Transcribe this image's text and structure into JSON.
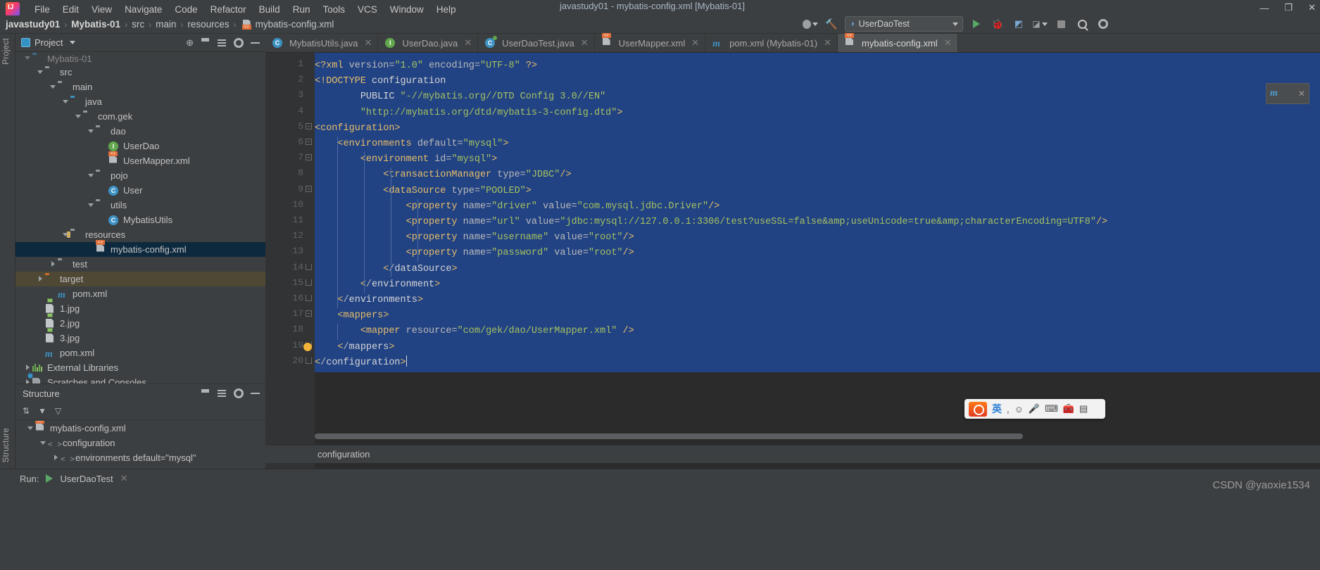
{
  "window": {
    "title": "javastudy01 - mybatis-config.xml [Mybatis-01]",
    "minimize": "—",
    "maximize": "❐",
    "close": "✕"
  },
  "menu": [
    {
      "label": "File"
    },
    {
      "label": "Edit"
    },
    {
      "label": "View"
    },
    {
      "label": "Navigate"
    },
    {
      "label": "Code"
    },
    {
      "label": "Refactor"
    },
    {
      "label": "Build"
    },
    {
      "label": "Run"
    },
    {
      "label": "Tools"
    },
    {
      "label": "VCS"
    },
    {
      "label": "Window"
    },
    {
      "label": "Help"
    }
  ],
  "breadcrumb": {
    "items": [
      "javastudy01",
      "Mybatis-01",
      "src",
      "main",
      "resources",
      "mybatis-config.xml"
    ],
    "separator": "›"
  },
  "run_config": {
    "name": "UserDaoTest",
    "run_icon": "play-icon",
    "debug_icon": "debug-icon",
    "coverage_icon": "coverage-icon",
    "profile_icon": "profile-icon",
    "stop_icon": "stop-icon",
    "search_icon": "search-icon",
    "settings_icon": "settings-icon",
    "avatar_icon": "user-icon",
    "build_icon": "hammer-icon"
  },
  "project_panel": {
    "title": "Project",
    "dropdown_icon": "chevron-down-icon",
    "toolbar_icons": [
      "target-icon",
      "collapse-all-icon",
      "expand-icon",
      "gear-icon",
      "hide-icon"
    ],
    "tree": [
      {
        "label": "Mybatis-01",
        "indent": 1,
        "arrow": "down",
        "icon": "module-icon",
        "state": "clipped"
      },
      {
        "label": "src",
        "indent": 2,
        "arrow": "down",
        "icon": "folder-icon"
      },
      {
        "label": "main",
        "indent": 3,
        "arrow": "down",
        "icon": "folder-icon"
      },
      {
        "label": "java",
        "indent": 4,
        "arrow": "down",
        "icon": "source-folder-icon"
      },
      {
        "label": "com.gek",
        "indent": 5,
        "arrow": "down",
        "icon": "package-icon"
      },
      {
        "label": "dao",
        "indent": 6,
        "arrow": "down",
        "icon": "package-icon"
      },
      {
        "label": "UserDao",
        "indent": 7,
        "arrow": "none",
        "icon": "interface-icon"
      },
      {
        "label": "UserMapper.xml",
        "indent": 7,
        "arrow": "none",
        "icon": "xml-icon"
      },
      {
        "label": "pojo",
        "indent": 6,
        "arrow": "down",
        "icon": "package-icon"
      },
      {
        "label": "User",
        "indent": 7,
        "arrow": "none",
        "icon": "class-icon"
      },
      {
        "label": "utils",
        "indent": 6,
        "arrow": "down",
        "icon": "package-icon"
      },
      {
        "label": "MybatisUtils",
        "indent": 7,
        "arrow": "none",
        "icon": "class-icon"
      },
      {
        "label": "resources",
        "indent": 4,
        "arrow": "down",
        "icon": "resource-folder-icon"
      },
      {
        "label": "mybatis-config.xml",
        "indent": 6,
        "arrow": "none",
        "icon": "xml-icon",
        "selected": true
      },
      {
        "label": "test",
        "indent": 3,
        "arrow": "right",
        "icon": "folder-icon"
      },
      {
        "label": "target",
        "indent": 2,
        "arrow": "right",
        "icon": "excluded-folder-icon",
        "highlight": true
      },
      {
        "label": "pom.xml",
        "indent": 3,
        "arrow": "none",
        "icon": "maven-icon"
      },
      {
        "label": "1.jpg",
        "indent": 2,
        "arrow": "none",
        "icon": "image-icon"
      },
      {
        "label": "2.jpg",
        "indent": 2,
        "arrow": "none",
        "icon": "image-icon"
      },
      {
        "label": "3.jpg",
        "indent": 2,
        "arrow": "none",
        "icon": "image-icon"
      },
      {
        "label": "pom.xml",
        "indent": 2,
        "arrow": "none",
        "icon": "maven-icon"
      },
      {
        "label": "External Libraries",
        "indent": 1,
        "arrow": "right",
        "icon": "library-icon"
      },
      {
        "label": "Scratches and Consoles",
        "indent": 1,
        "arrow": "right",
        "icon": "scratch-icon"
      }
    ]
  },
  "structure_panel": {
    "title": "Structure",
    "toolbar_icons": [
      "sort-icon",
      "expand-all-icon",
      "collapse-all-icon",
      "gear-icon",
      "hide-icon"
    ],
    "tree": [
      {
        "label": "mybatis-config.xml",
        "indent": 1,
        "arrow": "down",
        "icon": "xml-icon"
      },
      {
        "label": "configuration",
        "indent": 2,
        "arrow": "down",
        "icon": "tag-icon"
      },
      {
        "label": "environments default=\"mysql\"",
        "indent": 3,
        "arrow": "right",
        "icon": "tag-icon"
      }
    ]
  },
  "side_labels": {
    "project": "Project",
    "structure": "Structure"
  },
  "editor": {
    "tabs": [
      {
        "label": "MybatisUtils.java",
        "icon": "class-icon",
        "active": false,
        "close": "✕"
      },
      {
        "label": "UserDao.java",
        "icon": "interface-icon",
        "active": false,
        "close": "✕"
      },
      {
        "label": "UserDaoTest.java",
        "icon": "test-class-icon",
        "active": false,
        "close": "✕"
      },
      {
        "label": "UserMapper.xml",
        "icon": "xml-icon",
        "active": false,
        "close": "✕"
      },
      {
        "label": "pom.xml (Mybatis-01)",
        "icon": "maven-icon",
        "active": false,
        "close": "✕"
      },
      {
        "label": "mybatis-config.xml",
        "icon": "xml-icon",
        "active": true,
        "close": "✕"
      }
    ],
    "line_numbers": [
      1,
      2,
      3,
      4,
      5,
      6,
      7,
      8,
      9,
      10,
      11,
      12,
      13,
      14,
      15,
      16,
      17,
      18,
      19,
      20
    ],
    "lines": [
      "<?xml version=\"1.0\" encoding=\"UTF-8\" ?>",
      "<!DOCTYPE configuration",
      "        PUBLIC \"-//mybatis.org//DTD Config 3.0//EN\"",
      "        \"http://mybatis.org/dtd/mybatis-3-config.dtd\">",
      "<configuration>",
      "    <environments default=\"mysql\">",
      "        <environment id=\"mysql\">",
      "            <transactionManager type=\"JDBC\"/>",
      "            <dataSource type=\"POOLED\">",
      "                <property name=\"driver\" value=\"com.mysql.jdbc.Driver\"/>",
      "                <property name=\"url\" value=\"jdbc:mysql://127.0.0.1:3306/test?useSSL=false&amp;useUnicode=true&amp;characterEncoding=UTF8\"/>",
      "                <property name=\"username\" value=\"root\"/>",
      "                <property name=\"password\" value=\"root\"/>",
      "            </dataSource>",
      "        </environment>",
      "    </environments>",
      "    <mappers>",
      "        <mapper resource=\"com/gek/dao/UserMapper.xml\" />",
      "    </mappers>",
      "</configuration>"
    ],
    "bottom_breadcrumb": "configuration",
    "inspection_bulb_line": 19,
    "selection_color": "#214283"
  },
  "minimap_popup": {
    "icon": "maven-icon",
    "close": "✕"
  },
  "ime_bar": {
    "logo": "sogou-icon",
    "mode": "英",
    "items": [
      "comma-icon",
      "smiley-icon",
      "mic-icon",
      "keyboard-icon",
      "toolbox-icon",
      "menu-icon"
    ]
  },
  "run_bar": {
    "label": "Run:",
    "config_name": "UserDaoTest",
    "play_icon": "play-icon",
    "close": "✕"
  },
  "watermark": "CSDN @yaoxie1534",
  "colors": {
    "background": "#3c3f41",
    "editor_bg": "#2b2b2b",
    "gutter_bg": "#313335",
    "selection": "#214283",
    "tag": "#e8bf6a",
    "attr_value": "#a5c261",
    "attr_name": "#bababa",
    "tree_selected": "#0d293e",
    "target_highlight": "#4e4835",
    "accent_blue": "#3d92c4",
    "accent_green": "#62a74d",
    "accent_orange": "#cc6b2e"
  }
}
